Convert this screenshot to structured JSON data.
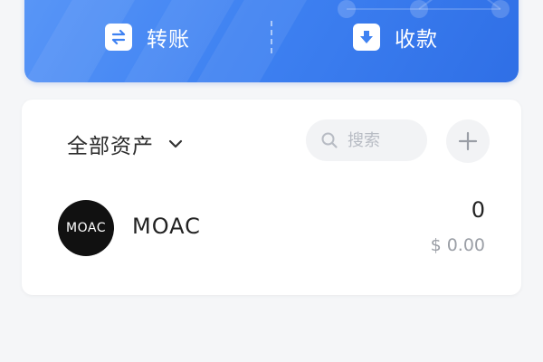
{
  "actions": {
    "transfer_label": "转账",
    "receive_label": "收款"
  },
  "assets": {
    "filter_label": "全部资产",
    "search_placeholder": "搜索",
    "items": [
      {
        "logo_text": "MOAC",
        "name": "MOAC",
        "amount": "0",
        "value": "$ 0.00"
      }
    ]
  },
  "colors": {
    "accent": "#3f82f2",
    "banner_start": "#5a97f7",
    "banner_end": "#2f6fe6",
    "background": "#f5f6f8"
  },
  "icons": {
    "transfer": "transfer-arrows-icon",
    "receive": "download-icon",
    "filter": "chevron-down-icon",
    "search": "search-icon",
    "add": "plus-icon"
  }
}
